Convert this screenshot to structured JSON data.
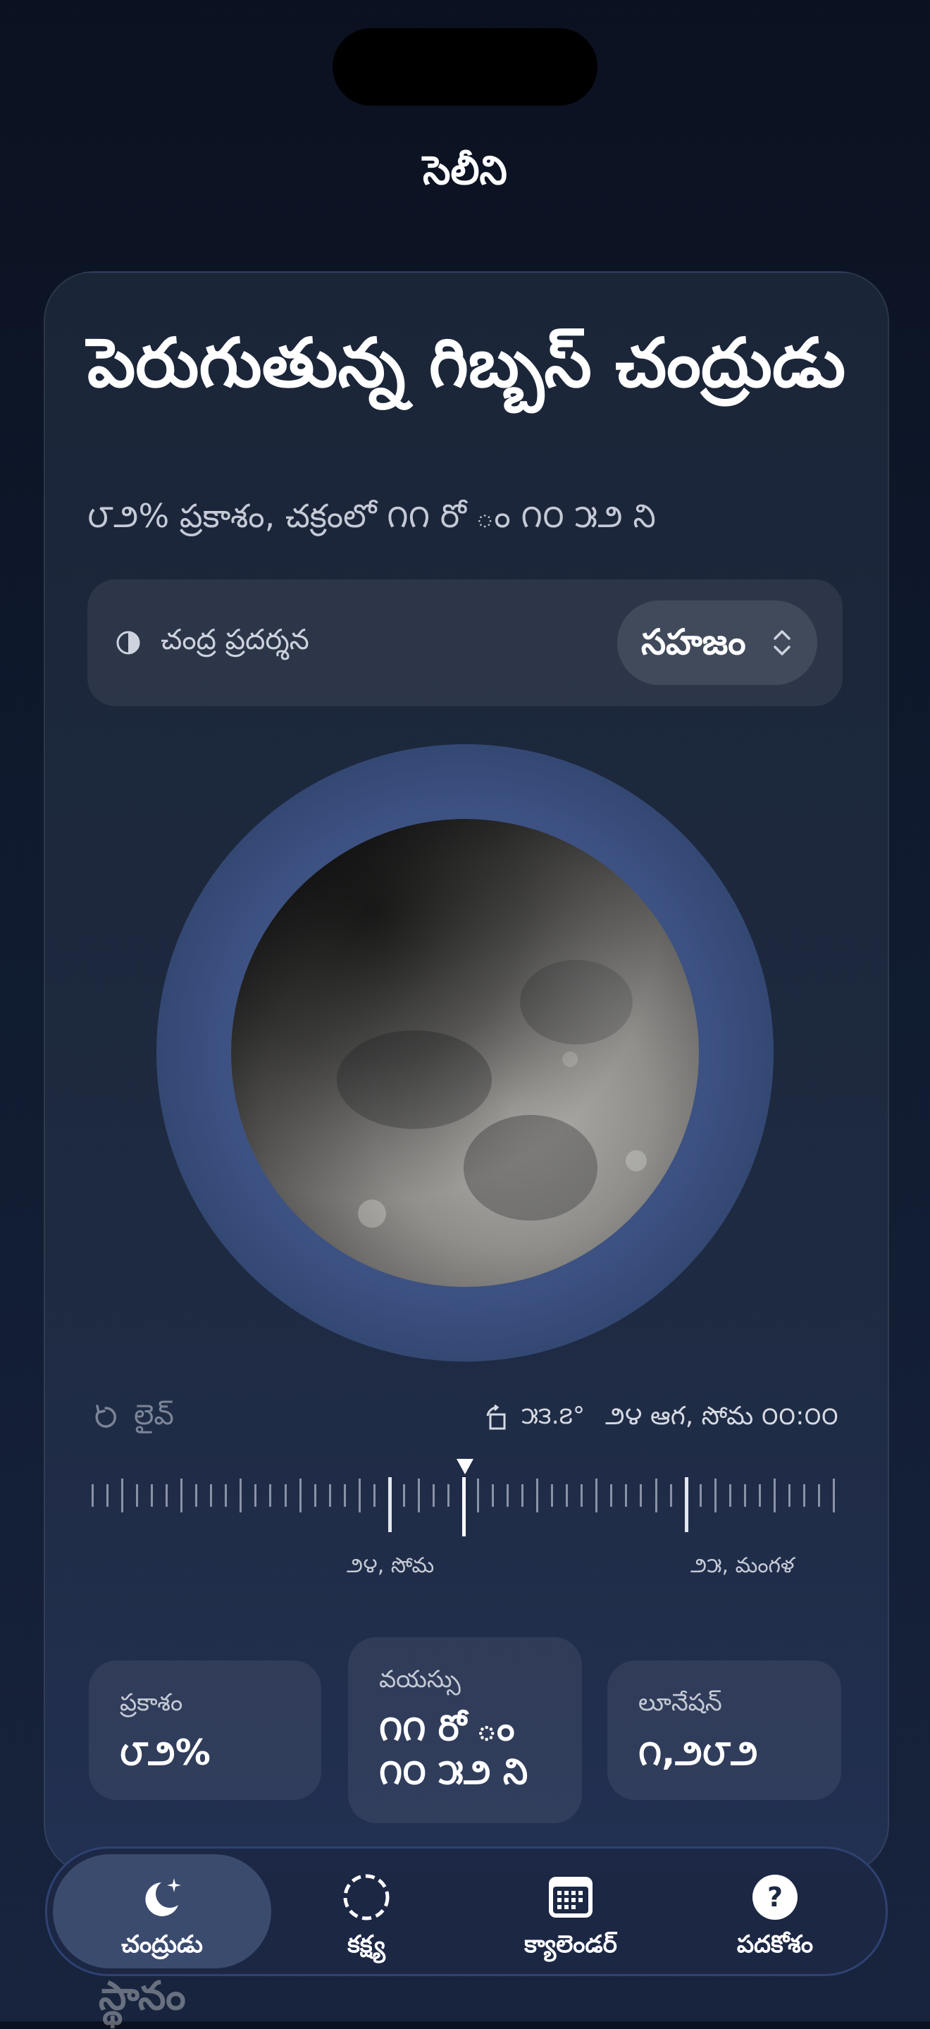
{
  "app": {
    "title": "సెలీని"
  },
  "phase": {
    "title": "పెరుగుతున్న గిబ్బస్ చంద్రుడు",
    "subtitle": "౮౨% ప్రకాశం, చక్రంలో ౧౧ రో ం ౧౦ ౫౨ ని"
  },
  "display": {
    "label": "చంద్ర ప్రదర్శన",
    "mode": "సహజం",
    "icon": "half-circle-icon"
  },
  "timeline": {
    "live_label": "లైవ్",
    "angle": "౫౩.౭°",
    "datetime": "౨౪ ఆగ, సోమ ౦౦:౦౦",
    "labels": [
      "౨౪, సోమ",
      "౨౫, మంగళ"
    ]
  },
  "stats": [
    {
      "label": "ప్రకాశం",
      "value": "౮౨%"
    },
    {
      "label": "వయస్సు",
      "value": "౧౧ రో ం\n౧౦ ౫౨ ని"
    },
    {
      "label": "లూనేషన్",
      "value": "౧,౨౮౨"
    }
  ],
  "peek_text": "స్థానం",
  "tabs": [
    {
      "label": "చంద్రుడు",
      "icon": "moon-stars-icon",
      "active": true
    },
    {
      "label": "కక్ష్య",
      "icon": "orbit-dashed-circle-icon",
      "active": false
    },
    {
      "label": "క్యాలెండర్",
      "icon": "calendar-icon",
      "active": false
    },
    {
      "label": "పదకోశం",
      "icon": "question-circle-icon",
      "active": false
    }
  ],
  "colors": {
    "accent": "#3d5283",
    "tab_active": "#3b4b6e",
    "background": "#0f1a2e"
  }
}
